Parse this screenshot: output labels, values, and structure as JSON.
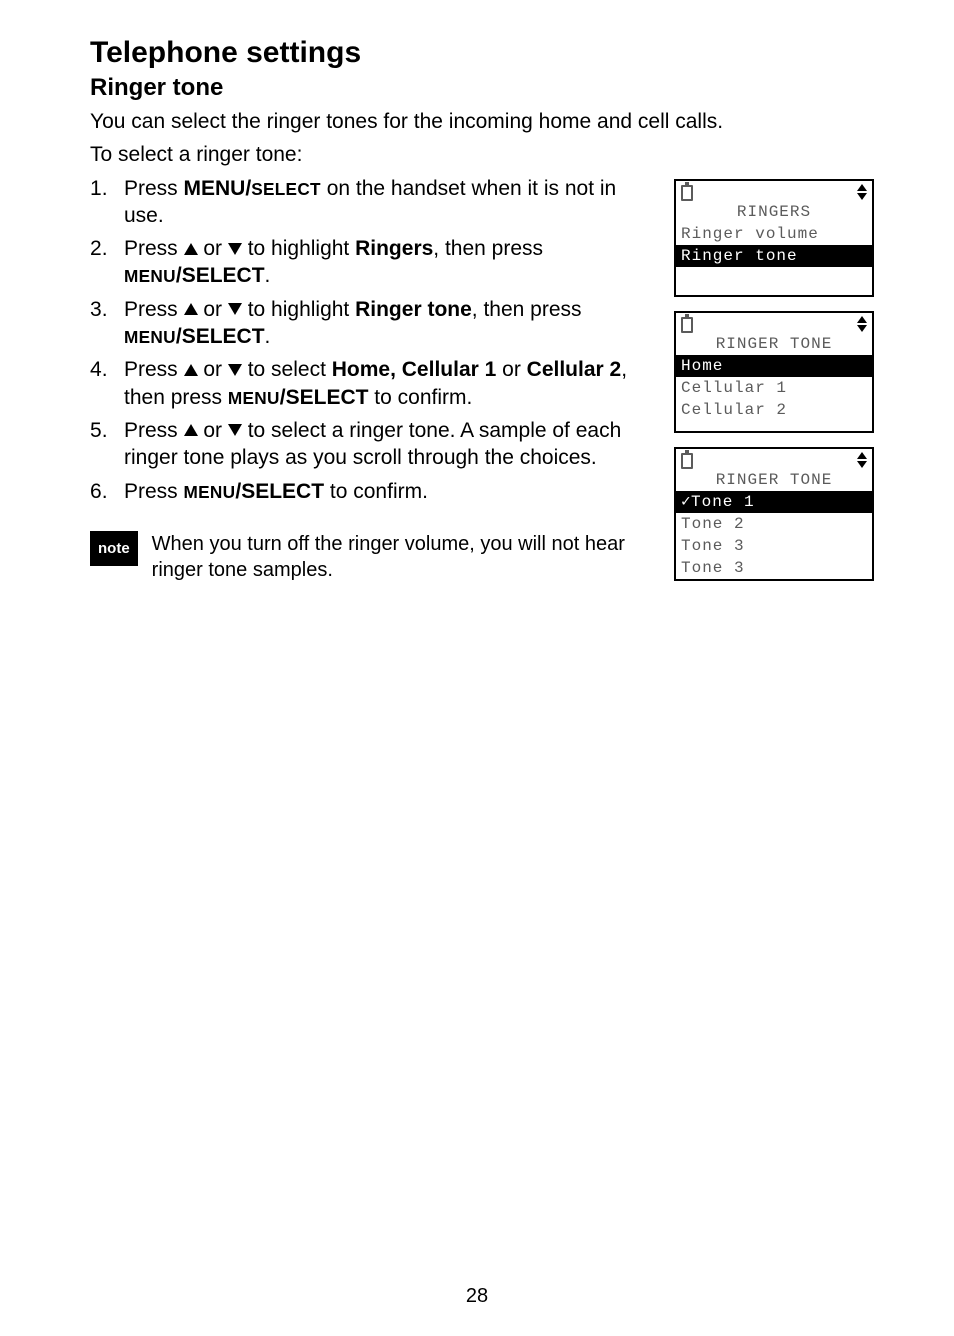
{
  "heading": "Telephone settings",
  "subheading": "Ringer tone",
  "intro_1": "You can select the ringer tones for the incoming home and cell calls.",
  "intro_2": "To select a ringer tone:",
  "steps": {
    "s1a": "Press ",
    "s1_menu": "MENU/",
    "s1_select": "SELECT",
    "s1b": " on the handset when it is not in use.",
    "s2a": "Press ",
    "s2_or": " or ",
    "s2b": " to highlight ",
    "s2_ringers": "Ringers",
    "s2c": ", then press ",
    "s3b": " to highlight ",
    "s3_rt": "Ringer tone",
    "s3c": ", then press ",
    "s4b": " to select ",
    "s4_hc": "Home, Cellular 1",
    "s4_or2": " or ",
    "s4_c2": "Cellular 2",
    "s4c": ", then press ",
    "s4d": " to confirm.",
    "s5b": " to select a ringer tone. A sample of each ringer tone plays as you scroll through the choices.",
    "s6a": "Press ",
    "s6b": " to confirm."
  },
  "note_label": "note",
  "note_text": "When you turn off the ringer volume, you will not hear ringer tone samples.",
  "screens": {
    "ringers": {
      "title": "RINGERS",
      "row1": "Ringer volume",
      "row2": "Ringer tone"
    },
    "ringer_tone_lines": {
      "title": "RINGER TONE",
      "row1": "Home",
      "row2": "Cellular 1",
      "row3": "Cellular 2"
    },
    "ringer_tone_tones": {
      "title": "RINGER TONE",
      "row1": "Tone 1",
      "row2": " Tone 2",
      "row3": " Tone 3",
      "row4": " Tone 3"
    }
  },
  "page_number": "28"
}
